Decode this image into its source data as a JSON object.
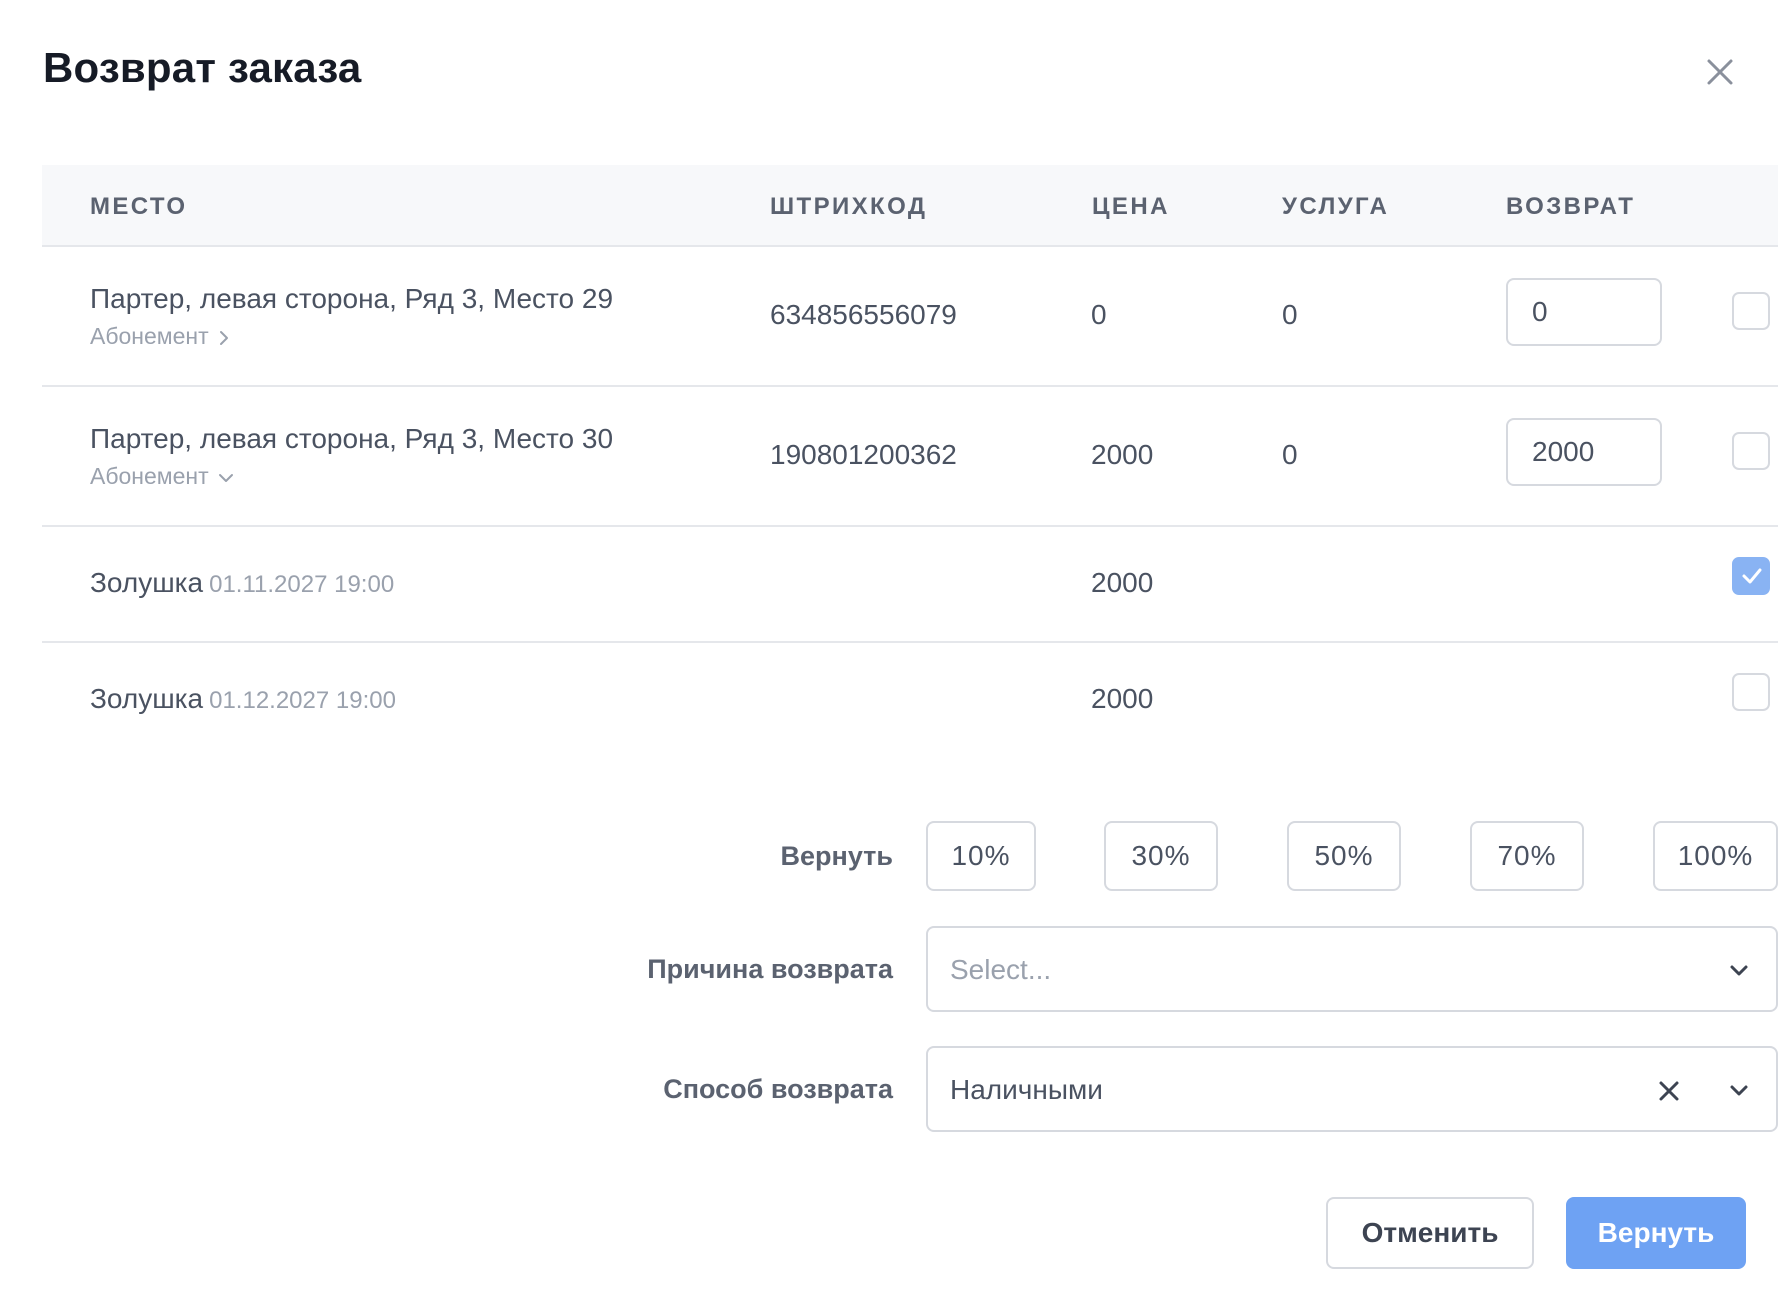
{
  "dialog": {
    "title": "Возврат заказа"
  },
  "table": {
    "headers": {
      "place": "МЕСТО",
      "barcode": "ШТРИХКОД",
      "price": "ЦЕНА",
      "service": "УСЛУГА",
      "refund": "ВОЗВРАТ"
    },
    "rows": [
      {
        "place": "Партер, левая сторона, Ряд 3, Место 29",
        "sub_label": "Абонемент",
        "sub_icon": "chevron-right-icon",
        "barcode": "634856556079",
        "price": "0",
        "service": "0",
        "refund": "0",
        "checked": false
      },
      {
        "place": "Партер, левая сторона, Ряд 3, Место 30",
        "sub_label": "Абонемент",
        "sub_icon": "chevron-down-icon",
        "barcode": "190801200362",
        "price": "2000",
        "service": "0",
        "refund": "2000",
        "checked": false
      },
      {
        "place": "Золушка",
        "date": "01.11.2027 19:00",
        "price": "2000",
        "checked": true
      },
      {
        "place": "Золушка",
        "date": "01.12.2027 19:00",
        "price": "2000",
        "checked": false
      }
    ]
  },
  "refund_percent": {
    "label": "Вернуть",
    "options": [
      "10%",
      "30%",
      "50%",
      "70%",
      "100%"
    ]
  },
  "reason": {
    "label": "Причина возврата",
    "placeholder": "Select..."
  },
  "method": {
    "label": "Способ возврата",
    "value": "Наличными"
  },
  "actions": {
    "cancel": "Отменить",
    "submit": "Вернуть"
  },
  "colors": {
    "primary": "#6ea2f3",
    "checkbox_checked": "#89b3f3",
    "header_bg": "#f7f8fa",
    "border": "#d6d9df"
  }
}
